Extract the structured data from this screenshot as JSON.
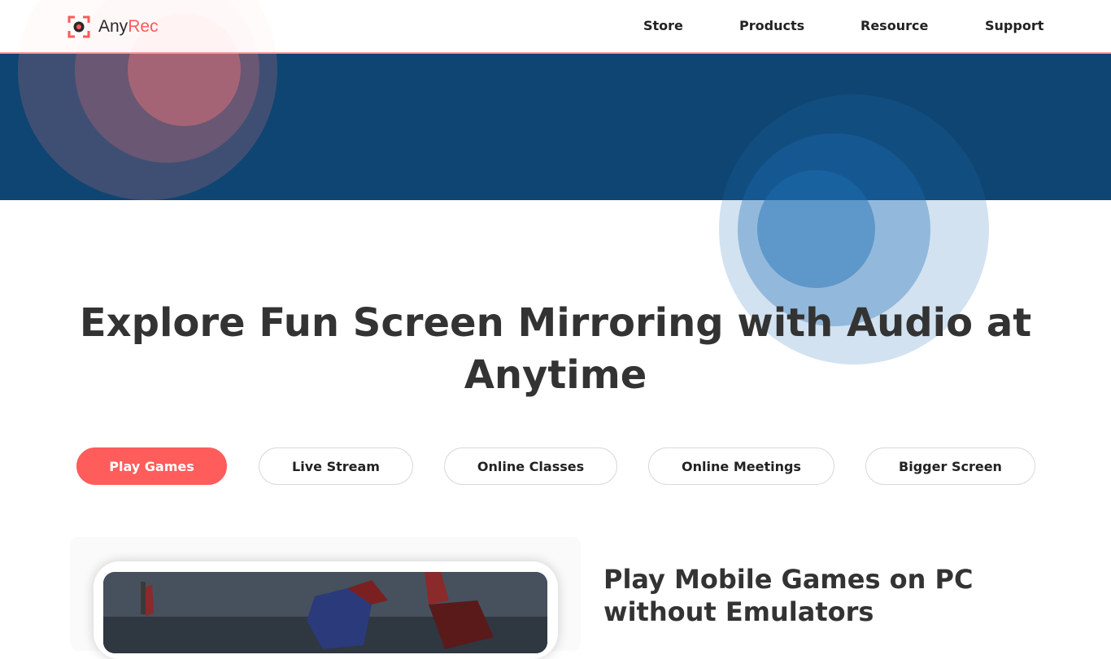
{
  "header": {
    "logo": {
      "text_main": "Any",
      "text_accent": "Rec"
    },
    "nav": [
      "Store",
      "Products",
      "Resource",
      "Support"
    ]
  },
  "hero": {
    "headline": "Explore Fun Screen Mirroring with Audio at Anytime"
  },
  "tabs": [
    {
      "label": "Play Games",
      "active": true
    },
    {
      "label": "Live Stream",
      "active": false
    },
    {
      "label": "Online Classes",
      "active": false
    },
    {
      "label": "Online Meetings",
      "active": false
    },
    {
      "label": "Bigger Screen",
      "active": false
    }
  ],
  "feature": {
    "title": "Play Mobile Games on PC without Emulators"
  },
  "colors": {
    "brand_accent": "#ff5c5c",
    "hero_band": "#0f4572",
    "text_dark": "#333333"
  },
  "icons": {
    "logo": "record-target-icon"
  }
}
